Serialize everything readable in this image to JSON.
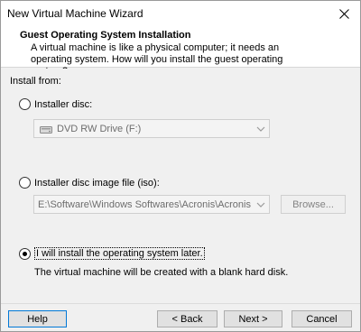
{
  "window": {
    "title": "New Virtual Machine Wizard"
  },
  "header": {
    "title": "Guest Operating System Installation",
    "description": "A virtual machine is like a physical computer; it needs an operating system. How will you install the guest operating system?"
  },
  "install_from": {
    "label": "Install from:",
    "options": {
      "installer_disc": {
        "label": "Installer disc:",
        "selected": false,
        "drive_value": "DVD RW Drive (F:)"
      },
      "iso": {
        "label": "Installer disc image file (iso):",
        "selected": false,
        "path_value": "E:\\Software\\Windows Softwares\\Acronis\\Acronis Adva",
        "browse_label": "Browse..."
      },
      "later": {
        "label": "I will install the operating system later.",
        "selected": true,
        "note": "The virtual machine will be created with a blank hard disk."
      }
    }
  },
  "footer": {
    "help_label": "Help",
    "back_label": "< Back",
    "next_label": "Next >",
    "cancel_label": "Cancel"
  },
  "icons": {
    "close": "close-icon",
    "disc_drive": "disc-drive-icon",
    "dropdown": "chevron-down-icon"
  },
  "colors": {
    "focus_border": "#0078d7",
    "dialog_bg": "#f0f0f0",
    "disabled_text": "#6d6d6d"
  }
}
